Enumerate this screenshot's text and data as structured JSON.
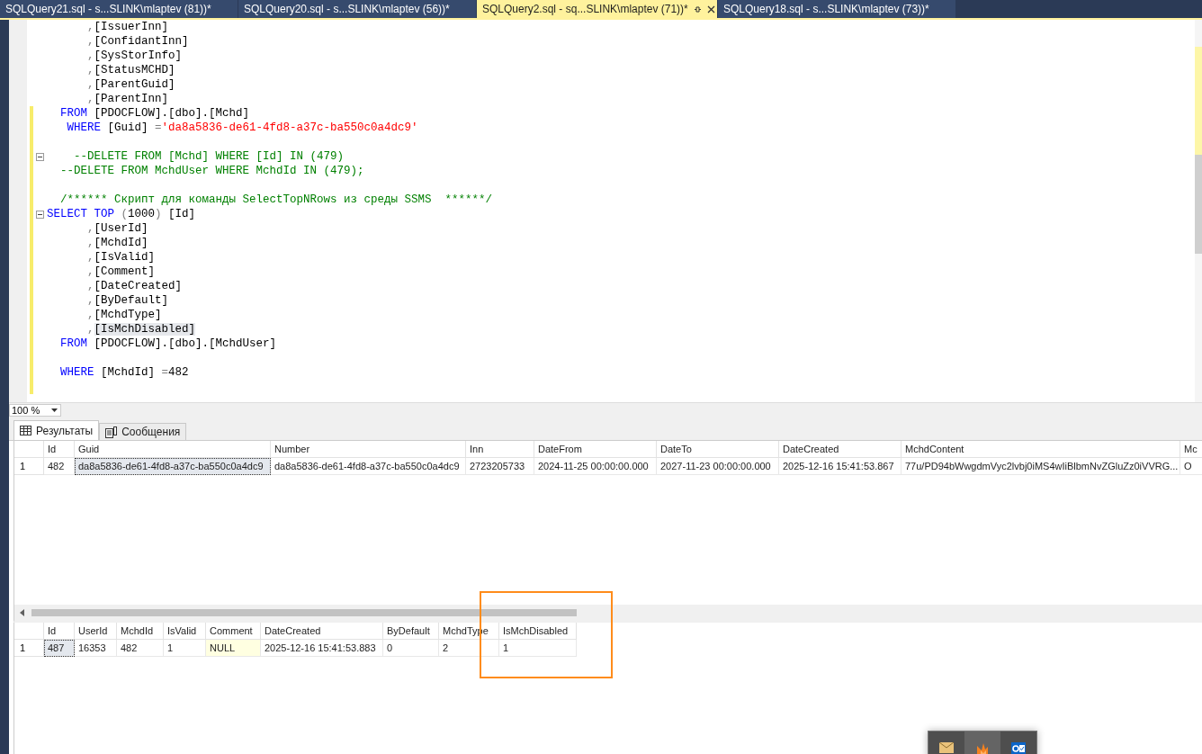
{
  "tabs": [
    {
      "label": "SQLQuery21.sql - s...SLINK\\mlaptev (81))*",
      "selected": false
    },
    {
      "label": "SQLQuery20.sql - s...SLINK\\mlaptev (56))*",
      "selected": false
    },
    {
      "label": "SQLQuery2.sql - sq...SLINK\\mlaptev (71))*",
      "selected": true
    },
    {
      "label": "SQLQuery18.sql - s...SLINK\\mlaptev (73))*",
      "selected": false
    }
  ],
  "editor": {
    "lines": [
      {
        "tokens": [
          {
            "text": "      ,",
            "kind": "op"
          },
          {
            "text": "[IssuerInn]",
            "kind": "id"
          }
        ]
      },
      {
        "tokens": [
          {
            "text": "      ,",
            "kind": "op"
          },
          {
            "text": "[ConfidantInn]",
            "kind": "id"
          }
        ]
      },
      {
        "tokens": [
          {
            "text": "      ,",
            "kind": "op"
          },
          {
            "text": "[SysStorInfo]",
            "kind": "id"
          }
        ]
      },
      {
        "tokens": [
          {
            "text": "      ,",
            "kind": "op"
          },
          {
            "text": "[StatusMCHD]",
            "kind": "id"
          }
        ]
      },
      {
        "tokens": [
          {
            "text": "      ,",
            "kind": "op"
          },
          {
            "text": "[ParentGuid]",
            "kind": "id"
          }
        ]
      },
      {
        "tokens": [
          {
            "text": "      ,",
            "kind": "op"
          },
          {
            "text": "[ParentInn]",
            "kind": "id"
          }
        ]
      },
      {
        "changed": true,
        "tokens": [
          {
            "text": "  FROM",
            "kind": "kw"
          },
          {
            "text": " [PDOCFLOW].[dbo].[Mchd]",
            "kind": "id"
          }
        ]
      },
      {
        "changed": true,
        "tokens": [
          {
            "text": "   WHERE",
            "kind": "kw"
          },
          {
            "text": " [Guid] ",
            "kind": "id"
          },
          {
            "text": "=",
            "kind": "op"
          },
          {
            "text": "'da8a5836-de61-4fd8-a37c-ba550c0a4dc9'",
            "kind": "str"
          }
        ]
      },
      {
        "changed": true
      },
      {
        "fold": true,
        "changed": true,
        "tokens": [
          {
            "text": "    --DELETE FROM [Mchd] WHERE [Id] IN (479)",
            "kind": "comment"
          }
        ]
      },
      {
        "changed": true,
        "tokens": [
          {
            "text": "  --DELETE FROM MchdUser WHERE MchdId IN (479);",
            "kind": "comment"
          }
        ]
      },
      {
        "changed": true
      },
      {
        "changed": true,
        "tokens": [
          {
            "text": "  /****** Скрипт для команды SelectTopNRows из среды SSMS  ******/",
            "kind": "comment"
          }
        ]
      },
      {
        "fold": true,
        "changed": true,
        "tokens": [
          {
            "text": "SELECT",
            "kind": "kw"
          },
          {
            "text": " TOP",
            "kind": "kw"
          },
          {
            "text": " (",
            "kind": "op"
          },
          {
            "text": "1000",
            "kind": "id"
          },
          {
            "text": ")",
            "kind": "op"
          },
          {
            "text": " [Id]",
            "kind": "id"
          }
        ]
      },
      {
        "changed": true,
        "tokens": [
          {
            "text": "      ,",
            "kind": "op"
          },
          {
            "text": "[UserId]",
            "kind": "id"
          }
        ]
      },
      {
        "changed": true,
        "tokens": [
          {
            "text": "      ,",
            "kind": "op"
          },
          {
            "text": "[MchdId]",
            "kind": "id"
          }
        ]
      },
      {
        "changed": true,
        "tokens": [
          {
            "text": "      ,",
            "kind": "op"
          },
          {
            "text": "[IsValid]",
            "kind": "id"
          }
        ]
      },
      {
        "changed": true,
        "tokens": [
          {
            "text": "      ,",
            "kind": "op"
          },
          {
            "text": "[Comment]",
            "kind": "id"
          }
        ]
      },
      {
        "changed": true,
        "tokens": [
          {
            "text": "      ,",
            "kind": "op"
          },
          {
            "text": "[DateCreated]",
            "kind": "id"
          }
        ]
      },
      {
        "changed": true,
        "tokens": [
          {
            "text": "      ,",
            "kind": "op"
          },
          {
            "text": "[ByDefault]",
            "kind": "id"
          }
        ]
      },
      {
        "changed": true,
        "tokens": [
          {
            "text": "      ,",
            "kind": "op"
          },
          {
            "text": "[MchdType]",
            "kind": "id"
          }
        ]
      },
      {
        "changed": true,
        "tokens": [
          {
            "text": "      ,",
            "kind": "op"
          },
          {
            "text": "[IsMchDisabled]",
            "kind": "hl"
          }
        ]
      },
      {
        "changed": true,
        "tokens": [
          {
            "text": "  FROM",
            "kind": "kw"
          },
          {
            "text": " [PDOCFLOW].[dbo].[MchdUser]",
            "kind": "id"
          }
        ]
      },
      {
        "changed": true
      },
      {
        "changed": true,
        "tokens": [
          {
            "text": "  WHERE",
            "kind": "kw"
          },
          {
            "text": " [MchdId] ",
            "kind": "id"
          },
          {
            "text": "=",
            "kind": "op"
          },
          {
            "text": "482",
            "kind": "id"
          }
        ]
      },
      {
        "changed": true
      }
    ]
  },
  "zoom": "100 %",
  "result_tabs": [
    {
      "label": "Результаты",
      "selected": true
    },
    {
      "label": "Сообщения",
      "selected": false
    }
  ],
  "grids": [
    {
      "columns": [
        "Id",
        "Guid",
        "Number",
        "Inn",
        "DateFrom",
        "DateTo",
        "DateCreated",
        "MchdContent",
        "Mc"
      ],
      "rows": [
        {
          "number": "1",
          "cells": [
            {
              "text": "482",
              "kind": "value",
              "selected": false
            },
            {
              "text": "da8a5836-de61-4fd8-a37c-ba550c0a4dc9",
              "kind": "value",
              "selected": true
            },
            {
              "text": "da8a5836-de61-4fd8-a37c-ba550c0a4dc9",
              "kind": "value",
              "selected": false
            },
            {
              "text": "2723205733",
              "kind": "value",
              "selected": false
            },
            {
              "text": "2024-11-25 00:00:00.000",
              "kind": "value",
              "selected": false
            },
            {
              "text": "2027-11-23 00:00:00.000",
              "kind": "value",
              "selected": false
            },
            {
              "text": "2025-12-16 15:41:53.867",
              "kind": "value",
              "selected": false
            },
            {
              "text": "77u/PD94bWwgdmVyc2lvbj0iMS4wIiBlbmNvZGluZz0iVVRG...",
              "kind": "value",
              "selected": false
            },
            {
              "text": "O",
              "kind": "value",
              "selected": false
            }
          ]
        }
      ]
    },
    {
      "columns": [
        "Id",
        "UserId",
        "MchdId",
        "IsValid",
        "Comment",
        "DateCreated",
        "ByDefault",
        "MchdType",
        "IsMchDisabled"
      ],
      "rows": [
        {
          "number": "1",
          "cells": [
            {
              "text": "487",
              "kind": "value",
              "selected": true
            },
            {
              "text": "16353",
              "kind": "value",
              "selected": false
            },
            {
              "text": "482",
              "kind": "value",
              "selected": false
            },
            {
              "text": "1",
              "kind": "value",
              "selected": false
            },
            {
              "text": "NULL",
              "kind": "null",
              "selected": false
            },
            {
              "text": "2025-12-16 15:41:53.883",
              "kind": "value",
              "selected": false
            },
            {
              "text": "0",
              "kind": "value",
              "selected": false
            },
            {
              "text": "2",
              "kind": "value",
              "selected": false
            },
            {
              "text": "1",
              "kind": "value",
              "selected": false
            }
          ]
        }
      ]
    }
  ]
}
